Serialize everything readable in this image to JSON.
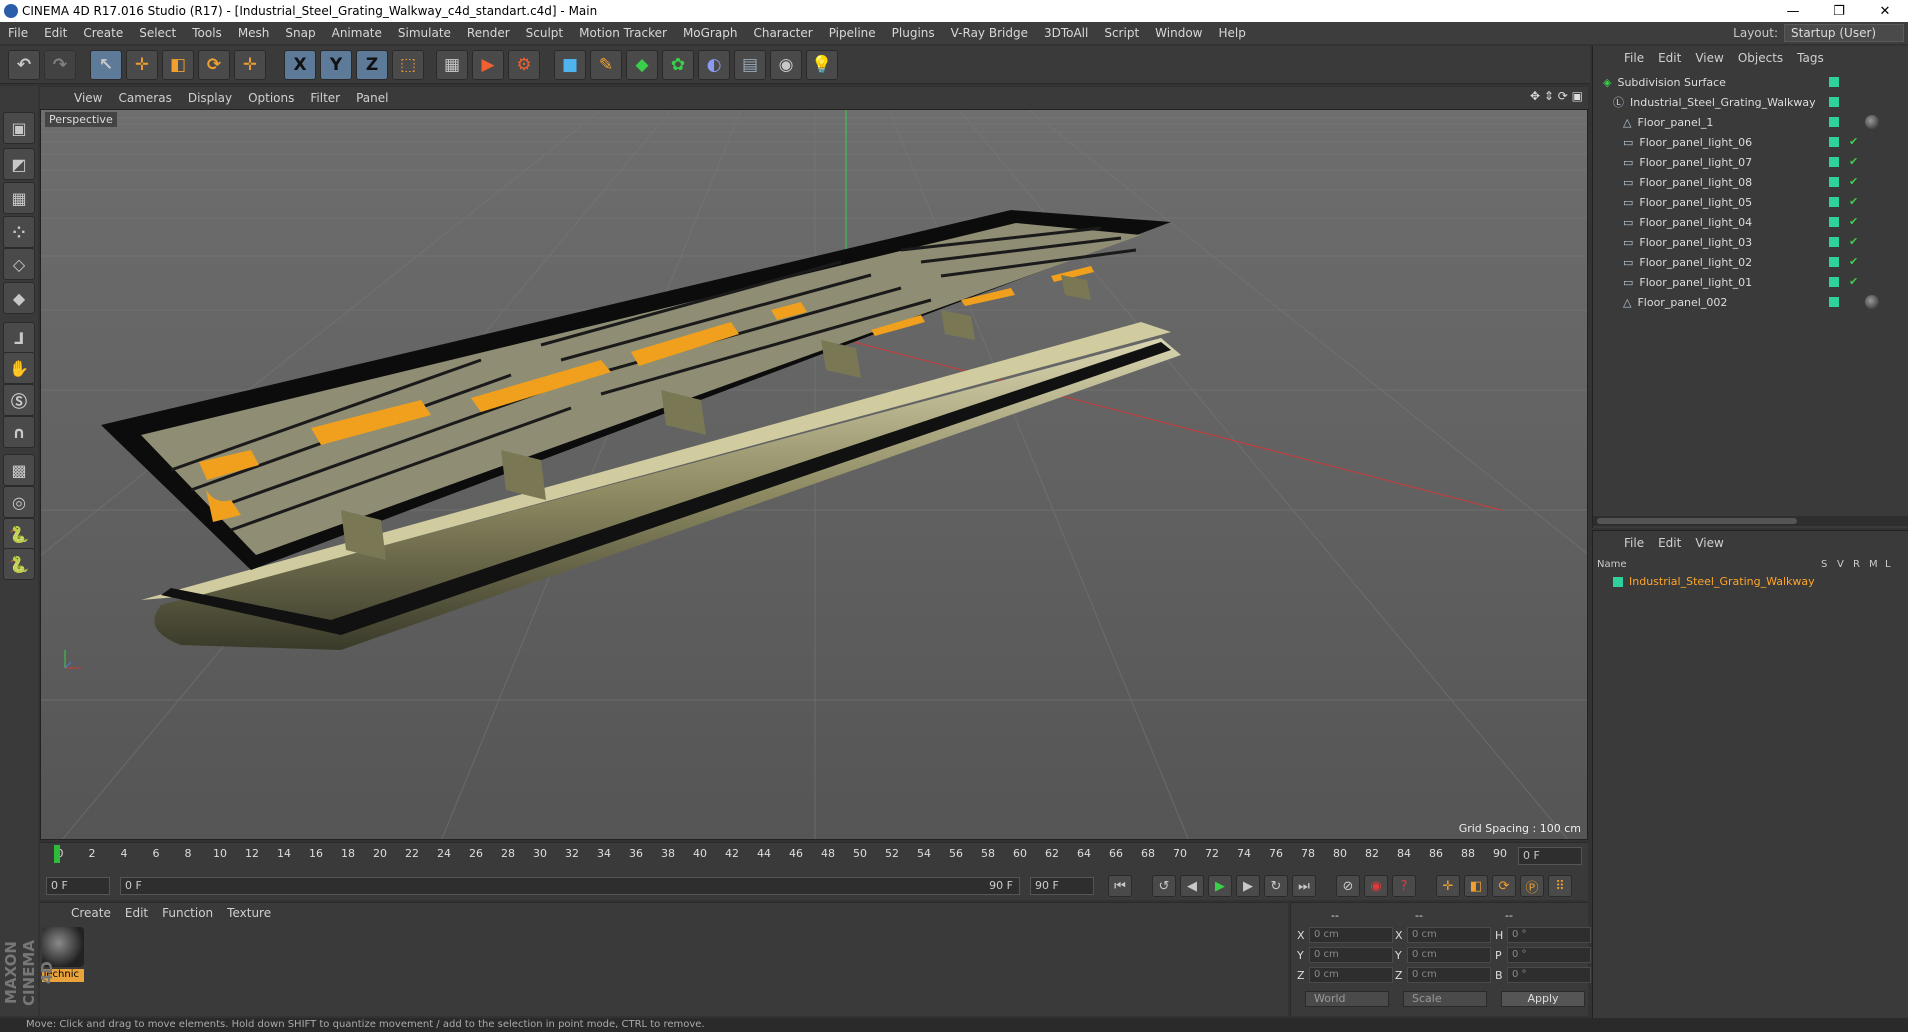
{
  "window": {
    "title": "CINEMA 4D R17.016 Studio (R17) - [Industrial_Steel_Grating_Walkway_c4d_standart.c4d] - Main",
    "minimize": "—",
    "restore": "❐",
    "close": "✕"
  },
  "menubar": [
    "File",
    "Edit",
    "Create",
    "Select",
    "Tools",
    "Mesh",
    "Snap",
    "Animate",
    "Simulate",
    "Render",
    "Sculpt",
    "Motion Tracker",
    "MoGraph",
    "Character",
    "Pipeline",
    "Plugins",
    "V-Ray Bridge",
    "3DToAll",
    "Script",
    "Window",
    "Help"
  ],
  "layout": {
    "label": "Layout:",
    "value": "Startup (User)"
  },
  "toolbar": {
    "undo": "↶",
    "redo": "↷",
    "select": "↖",
    "move": "✛",
    "scale": "◧",
    "rotate": "⟳",
    "last_tool": "✛",
    "x_axis": "X",
    "y_axis": "Y",
    "z_axis": "Z",
    "coord": "⬚",
    "render_view": "▦",
    "render_pv": "▶",
    "render_settings": "⚙",
    "cube": "■",
    "spline": "✎",
    "nurbs": "◆",
    "array": "✿",
    "deformer": "◐",
    "floor": "▤",
    "camera": "◉",
    "light": "💡"
  },
  "left_tools": [
    "model-mode",
    "texture-mode",
    "workplane",
    "points",
    "edges",
    "polygons",
    "axis",
    "tweak",
    "snap",
    "magnet",
    "grid-lock",
    "enable-snap",
    "python",
    "python2"
  ],
  "viewport": {
    "menu": [
      "View",
      "Cameras",
      "Display",
      "Options",
      "Filter",
      "Panel"
    ],
    "label": "Perspective",
    "grid_spacing": "Grid Spacing : 100 cm",
    "nav": "✥ ⇕ ⟳ ▣"
  },
  "timeline": {
    "ticks": [
      "0",
      "2",
      "4",
      "6",
      "8",
      "10",
      "12",
      "14",
      "16",
      "18",
      "20",
      "22",
      "24",
      "26",
      "28",
      "30",
      "32",
      "34",
      "36",
      "38",
      "40",
      "42",
      "44",
      "46",
      "48",
      "50",
      "52",
      "54",
      "56",
      "58",
      "60",
      "62",
      "64",
      "66",
      "68",
      "70",
      "72",
      "74",
      "76",
      "78",
      "80",
      "82",
      "84",
      "86",
      "88",
      "90"
    ],
    "current_frame": "0 F",
    "start": "0 F",
    "range_start": "0 F",
    "range_end": "90 F",
    "end": "90 F"
  },
  "materials": {
    "menu": [
      "Create",
      "Edit",
      "Function",
      "Texture"
    ],
    "items": [
      {
        "name": "Technic"
      }
    ]
  },
  "coords": {
    "header": [
      "--",
      "--",
      "--"
    ],
    "rows": [
      {
        "a": "X",
        "av": "0 cm",
        "b": "X",
        "bv": "0 cm",
        "c": "H",
        "cv": "0 °"
      },
      {
        "a": "Y",
        "av": "0 cm",
        "b": "Y",
        "bv": "0 cm",
        "c": "P",
        "cv": "0 °"
      },
      {
        "a": "Z",
        "av": "0 cm",
        "b": "Z",
        "bv": "0 cm",
        "c": "B",
        "cv": "0 °"
      }
    ],
    "world": "World",
    "scale": "Scale",
    "apply": "Apply"
  },
  "objects": {
    "menu": [
      "File",
      "Edit",
      "View",
      "Objects",
      "Tags"
    ],
    "items": [
      {
        "name": "Subdivision Surface",
        "indent": 0
      },
      {
        "name": "Industrial_Steel_Grating_Walkway",
        "indent": 1
      },
      {
        "name": "Floor_panel_1",
        "indent": 2
      },
      {
        "name": "Floor_panel_light_06",
        "indent": 2
      },
      {
        "name": "Floor_panel_light_07",
        "indent": 2
      },
      {
        "name": "Floor_panel_light_08",
        "indent": 2
      },
      {
        "name": "Floor_panel_light_05",
        "indent": 2
      },
      {
        "name": "Floor_panel_light_04",
        "indent": 2
      },
      {
        "name": "Floor_panel_light_03",
        "indent": 2
      },
      {
        "name": "Floor_panel_light_02",
        "indent": 2
      },
      {
        "name": "Floor_panel_light_01",
        "indent": 2
      },
      {
        "name": "Floor_panel_002",
        "indent": 2
      }
    ]
  },
  "layers": {
    "menu": [
      "File",
      "Edit",
      "View"
    ],
    "columns": {
      "name": "Name",
      "s": "S",
      "v": "V",
      "r": "R",
      "m": "M",
      "l": "L"
    },
    "items": [
      {
        "name": "Industrial_Steel_Grating_Walkway"
      }
    ]
  },
  "status": "Move: Click and drag to move elements. Hold down SHIFT to quantize movement / add to the selection in point mode, CTRL to remove.",
  "brand": "MAXON CINEMA 4D",
  "colors": {
    "tag_green": "#2dd39a",
    "layer_orange": "#ffa62b",
    "accent_blue": "#5d7a99"
  }
}
